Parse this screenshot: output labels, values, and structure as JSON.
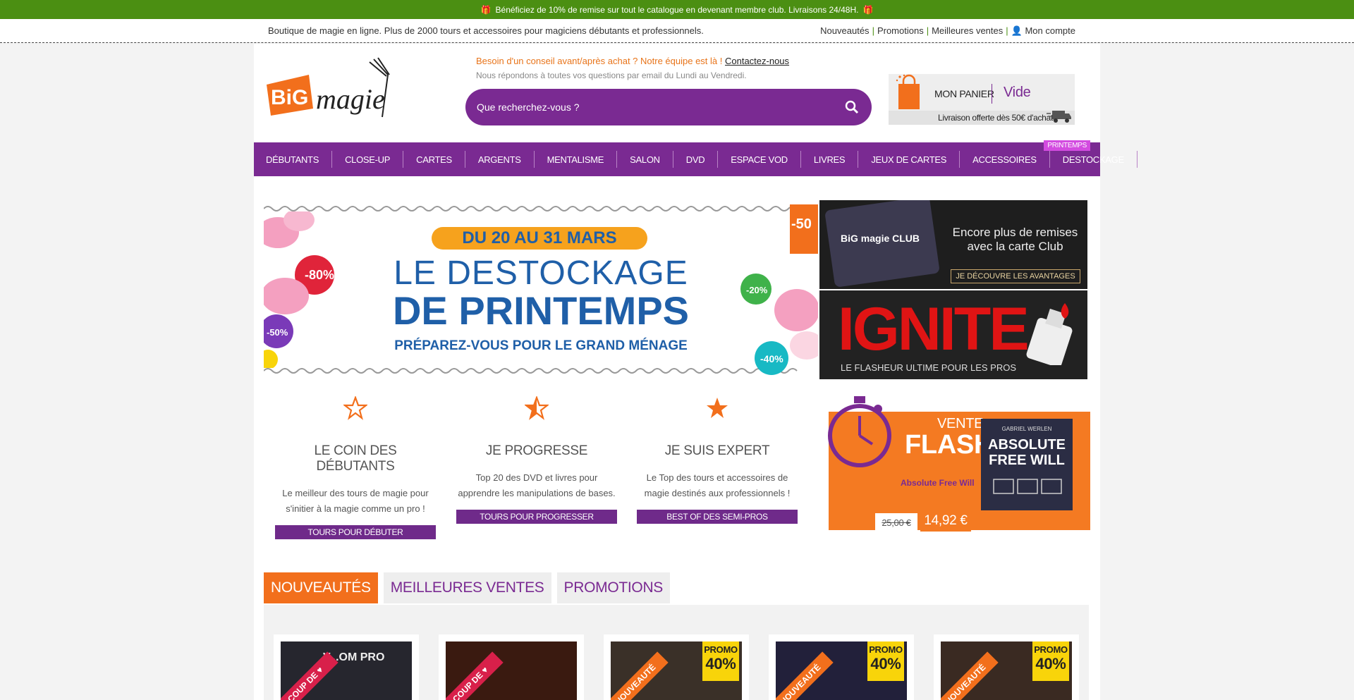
{
  "topbar": {
    "text": "Bénéficiez de 10% de remise sur tout le catalogue en devenant membre club. Livraisons 24/48H."
  },
  "subbar": {
    "tagline": "Boutique de magie en ligne. Plus de 2000 tours et accessoires pour magiciens débutants et professionnels.",
    "links": [
      "Nouveautés",
      "Promotions",
      "Meilleures ventes",
      "Mon compte"
    ]
  },
  "logo": {
    "text1": "BiG",
    "text2": "magie"
  },
  "advice": {
    "line1": "Besoin d'un conseil avant/après achat ? Notre équipe est là ! ",
    "link": "Contactez-nous",
    "line2": "Nous répondons à toutes vos questions par email du Lundi au Vendredi."
  },
  "search": {
    "placeholder": "Que recherchez-vous ?"
  },
  "cart": {
    "label": "MON PANIER",
    "value": "Vide",
    "shipping": "Livraison offerte dès 50€ d'achats"
  },
  "nav": {
    "items": [
      "DÉBUTANTS",
      "CLOSE-UP",
      "CARTES",
      "ARGENTS",
      "MENTALISME",
      "SALON",
      "DVD",
      "ESPACE VOD",
      "LIVRES",
      "JEUX DE CARTES",
      "ACCESSOIRES",
      "DESTOCKAGE"
    ],
    "badge": "PRINTEMPS"
  },
  "hero": {
    "dates": "DU 20 AU 31 MARS",
    "title1": "LE DESTOCKAGE",
    "title2": "DE PRINTEMPS",
    "subtitle": "PRÉPAREZ-VOUS POUR LE GRAND MÉNAGE",
    "tags": [
      "-80%",
      "-50%",
      "-20%",
      "-40%",
      "-50"
    ]
  },
  "club": {
    "text": "Encore plus de remises avec la carte Club",
    "button": "JE DÉCOUVRE LES AVANTAGES",
    "card_logo": "BiG magie CLUB"
  },
  "ignite": {
    "title": "IGNITE",
    "subtitle": "LE FLASHEUR ULTIME POUR LES PROS"
  },
  "columns": [
    {
      "title": "LE COIN DES DÉBUTANTS",
      "text": "Le meilleur des tours de magie pour s'initier à la magie comme un pro !",
      "button": "TOURS POUR DÉBUTER"
    },
    {
      "title": "JE PROGRESSE",
      "text": "Top 20 des DVD et livres pour apprendre les manipulations de bases.",
      "button": "TOURS POUR PROGRESSER"
    },
    {
      "title": "JE SUIS EXPERT",
      "text": "Le Top des tours et accessoires de magie destinés aux professionnels !",
      "button": "BEST OF DES SEMI-PROS"
    }
  ],
  "flash": {
    "vente": "VENTE",
    "flash": "FLASH",
    "product_name": "Absolute Free Will",
    "product_author": "GABRIEL WERLEN",
    "product_title": "ABSOLUTE FREE WILL",
    "old_price": "25,00 €",
    "new_price": "14,92 €"
  },
  "tabs": [
    {
      "label": "NOUVEAUTÉS",
      "active": true
    },
    {
      "label": "MEILLEURES VENTES",
      "active": false
    },
    {
      "label": "PROMOTIONS",
      "active": false
    }
  ],
  "products": [
    {
      "ribbon": "COUP DE ♥",
      "ribbon_type": "heart",
      "caption": "V...OM PRO",
      "promo": false
    },
    {
      "ribbon": "COUP DE ♥",
      "ribbon_type": "heart",
      "caption": "",
      "promo": false
    },
    {
      "ribbon": "NOUVEAUTÉ",
      "ribbon_type": "new",
      "caption": "",
      "promo": true,
      "promo_label": "PROMO",
      "promo_value": "40%"
    },
    {
      "ribbon": "NOUVEAUTÉ",
      "ribbon_type": "new",
      "caption": "",
      "promo": true,
      "promo_label": "PROMO",
      "promo_value": "40%"
    },
    {
      "ribbon": "NOUVEAUTÉ",
      "ribbon_type": "new",
      "caption": "",
      "promo": true,
      "promo_label": "PROMO",
      "promo_value": "40%"
    }
  ],
  "colors": {
    "green": "#4b8f12",
    "purple": "#7a2a92",
    "orange": "#f26f1c",
    "hero_blue": "#1f5fa8"
  }
}
